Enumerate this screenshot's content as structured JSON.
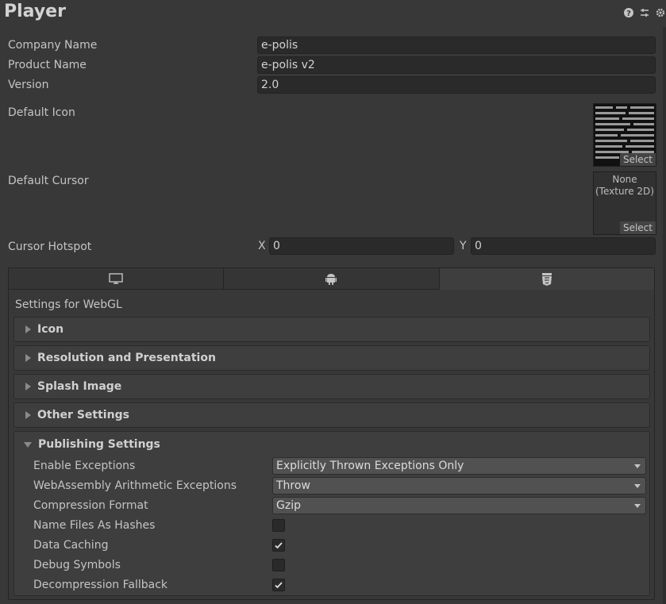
{
  "header": {
    "title": "Player",
    "icons": [
      "help-icon",
      "preset-icon",
      "gear-icon"
    ]
  },
  "fields": {
    "company_name": {
      "label": "Company Name",
      "value": "e-polis"
    },
    "product_name": {
      "label": "Product Name",
      "value": "e-polis v2"
    },
    "version": {
      "label": "Version",
      "value": "2.0"
    },
    "default_icon": {
      "label": "Default Icon",
      "select": "Select"
    },
    "default_cursor": {
      "label": "Default Cursor",
      "none": "None",
      "type": "(Texture 2D)",
      "select": "Select"
    },
    "cursor_hotspot": {
      "label": "Cursor Hotspot",
      "x_label": "X",
      "x_value": "0",
      "y_label": "Y",
      "y_value": "0"
    }
  },
  "platform_tabs": [
    {
      "icon": "monitor-icon"
    },
    {
      "icon": "android-icon"
    },
    {
      "icon": "html5-icon",
      "active": true
    }
  ],
  "settings_for": "Settings for WebGL",
  "sections": [
    "Icon",
    "Resolution and Presentation",
    "Splash Image",
    "Other Settings"
  ],
  "publishing": {
    "title": "Publishing Settings",
    "enable_exceptions": {
      "label": "Enable Exceptions",
      "value": "Explicitly Thrown Exceptions Only"
    },
    "wasm_arith": {
      "label": "WebAssembly Arithmetic Exceptions",
      "value": "Throw"
    },
    "compression": {
      "label": "Compression Format",
      "value": "Gzip"
    },
    "name_files": {
      "label": "Name Files As Hashes",
      "checked": false
    },
    "data_caching": {
      "label": "Data Caching",
      "checked": true
    },
    "debug_symbols": {
      "label": "Debug Symbols",
      "checked": false
    },
    "decompression_fallback": {
      "label": "Decompression Fallback",
      "checked": true
    }
  },
  "colors": {
    "bg": "#383838",
    "field": "#2a2a2a",
    "section": "#3e3e3e",
    "dropdown": "#515151"
  }
}
